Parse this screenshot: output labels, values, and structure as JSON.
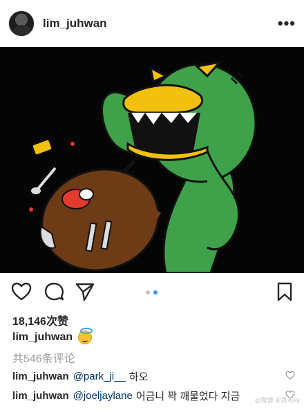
{
  "header": {
    "username": "lim_juhwan",
    "more_label": "•••"
  },
  "post": {
    "carousel_total": 2,
    "carousel_active": 2
  },
  "likes": {
    "text": "18,146次赞"
  },
  "caption": {
    "username": "lim_juhwan",
    "emoji_icon": "smiling-face-with-halo-icon"
  },
  "comments_link": {
    "text": "共546条评论"
  },
  "comments": [
    {
      "username": "lim_juhwan",
      "mention": "@park_ji__",
      "text": "하오"
    },
    {
      "username": "lim_juhwan",
      "mention": "@joeljaylane",
      "text": "어금니 꽉 깨물었다 지금"
    }
  ],
  "watermark": {
    "text": "@微博 安卿可kk"
  },
  "colors": {
    "link_blue": "#003569",
    "dot_active": "#3897f0",
    "monster_green": "#3fa24a",
    "beak_yellow": "#f2c10f",
    "background": "#050505"
  }
}
